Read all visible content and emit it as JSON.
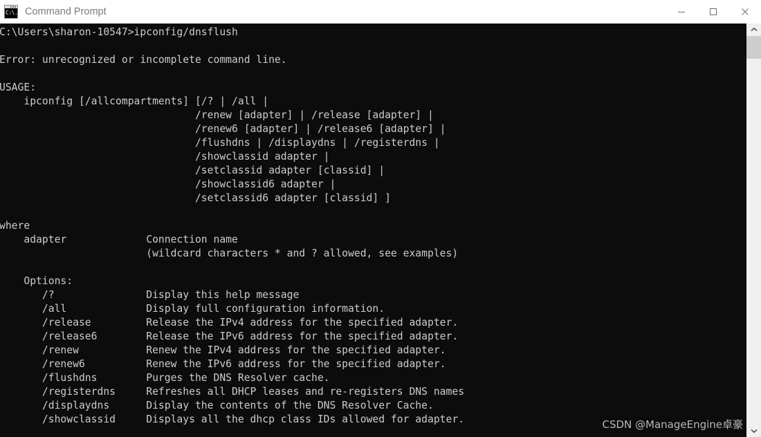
{
  "window": {
    "title": "Command Prompt",
    "icon": "cmd-icon",
    "icon_glyph": "C:\\.",
    "background_color": "#0c0c0c",
    "titlebar_color": "#ffffff",
    "text_color": "#cccccc",
    "controls": [
      {
        "name": "minimize",
        "glyph": "—"
      },
      {
        "name": "maximize",
        "glyph": "□"
      },
      {
        "name": "close",
        "glyph": "✕"
      }
    ]
  },
  "console": {
    "prompt": "C:\\Users\\sharon-10547>",
    "command": "ipconfig/dnsflush",
    "error": "Error: unrecognized or incomplete command line.",
    "usage_heading": "USAGE:",
    "usage_lines": [
      "    ipconfig [/allcompartments] [/? | /all |",
      "                                /renew [adapter] | /release [adapter] |",
      "                                /renew6 [adapter] | /release6 [adapter] |",
      "                                /flushdns | /displaydns | /registerdns |",
      "                                /showclassid adapter |",
      "                                /setclassid adapter [classid] |",
      "                                /showclassid6 adapter |",
      "                                /setclassid6 adapter [classid] ]"
    ],
    "where_heading": "where",
    "where_lines": [
      "    adapter             Connection name",
      "                        (wildcard characters * and ? allowed, see examples)"
    ],
    "options_heading": "    Options:",
    "options": [
      {
        "flag": "/?",
        "description": "Display this help message"
      },
      {
        "flag": "/all",
        "description": "Display full configuration information."
      },
      {
        "flag": "/release",
        "description": "Release the IPv4 address for the specified adapter."
      },
      {
        "flag": "/release6",
        "description": "Release the IPv6 address for the specified adapter."
      },
      {
        "flag": "/renew",
        "description": "Renew the IPv4 address for the specified adapter."
      },
      {
        "flag": "/renew6",
        "description": "Renew the IPv6 address for the specified adapter."
      },
      {
        "flag": "/flushdns",
        "description": "Purges the DNS Resolver cache."
      },
      {
        "flag": "/registerdns",
        "description": "Refreshes all DHCP leases and re-registers DNS names"
      },
      {
        "flag": "/displaydns",
        "description": "Display the contents of the DNS Resolver Cache."
      },
      {
        "flag": "/showclassid",
        "description": "Displays all the dhcp class IDs allowed for adapter."
      }
    ],
    "full_text": "C:\\Users\\sharon-10547>ipconfig/dnsflush\n\nError: unrecognized or incomplete command line.\n\nUSAGE:\n    ipconfig [/allcompartments] [/? | /all |\n                                /renew [adapter] | /release [adapter] |\n                                /renew6 [adapter] | /release6 [adapter] |\n                                /flushdns | /displaydns | /registerdns |\n                                /showclassid adapter |\n                                /setclassid adapter [classid] |\n                                /showclassid6 adapter |\n                                /setclassid6 adapter [classid] ]\n\nwhere\n    adapter             Connection name\n                        (wildcard characters * and ? allowed, see examples)\n\n    Options:\n       /?               Display this help message\n       /all             Display full configuration information.\n       /release         Release the IPv4 address for the specified adapter.\n       /release6        Release the IPv6 address for the specified adapter.\n       /renew           Renew the IPv4 address for the specified adapter.\n       /renew6          Renew the IPv6 address for the specified adapter.\n       /flushdns        Purges the DNS Resolver cache.\n       /registerdns     Refreshes all DHCP leases and re-registers DNS names\n       /displaydns      Display the contents of the DNS Resolver Cache.\n       /showclassid     Displays all the dhcp class IDs allowed for adapter."
  },
  "scrollbar": {
    "up_arrow": "scroll-up-icon",
    "down_arrow": "scroll-down-icon",
    "thumb": "scroll-thumb"
  },
  "watermark": {
    "text": "CSDN @ManageEngine卓豪"
  }
}
